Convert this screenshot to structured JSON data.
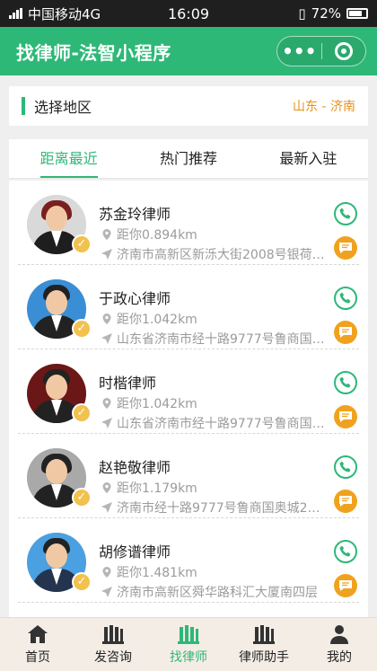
{
  "status": {
    "carrier": "中国移动4G",
    "time": "16:09",
    "battery": "72%"
  },
  "app": {
    "title": "找律师-法智小程序",
    "accent": "#2eb877",
    "orange": "#f0a21f"
  },
  "region": {
    "label": "选择地区",
    "value": "山东 - 济南"
  },
  "tabs": [
    {
      "label": "距离最近",
      "active": true
    },
    {
      "label": "热门推荐",
      "active": false
    },
    {
      "label": "最新入驻",
      "active": false
    }
  ],
  "lawyers": [
    {
      "name": "苏金玲律师",
      "distance": "距你0.894km",
      "address": "济南市高新区新泺大街2008号银荷大..."
    },
    {
      "name": "于政心律师",
      "distance": "距你1.042km",
      "address": "山东省济南市经十路9777号鲁商国奥..."
    },
    {
      "name": "时楷律师",
      "distance": "距你1.042km",
      "address": "山东省济南市经十路9777号鲁商国奥..."
    },
    {
      "name": "赵艳敬律师",
      "distance": "距你1.179km",
      "address": "济南市经十路9777号鲁商国奥城2号..."
    },
    {
      "name": "胡修谱律师",
      "distance": "距你1.481km",
      "address": "济南市高新区舜华路科汇大厦南四层"
    }
  ],
  "tabbar": [
    {
      "label": "首页",
      "icon": "home-icon",
      "active": false
    },
    {
      "label": "发咨询",
      "icon": "consult-icon",
      "active": false
    },
    {
      "label": "找律师",
      "icon": "find-lawyer-icon",
      "active": true
    },
    {
      "label": "律师助手",
      "icon": "lawyer-assistant-icon",
      "active": false
    },
    {
      "label": "我的",
      "icon": "profile-icon",
      "active": false
    }
  ]
}
